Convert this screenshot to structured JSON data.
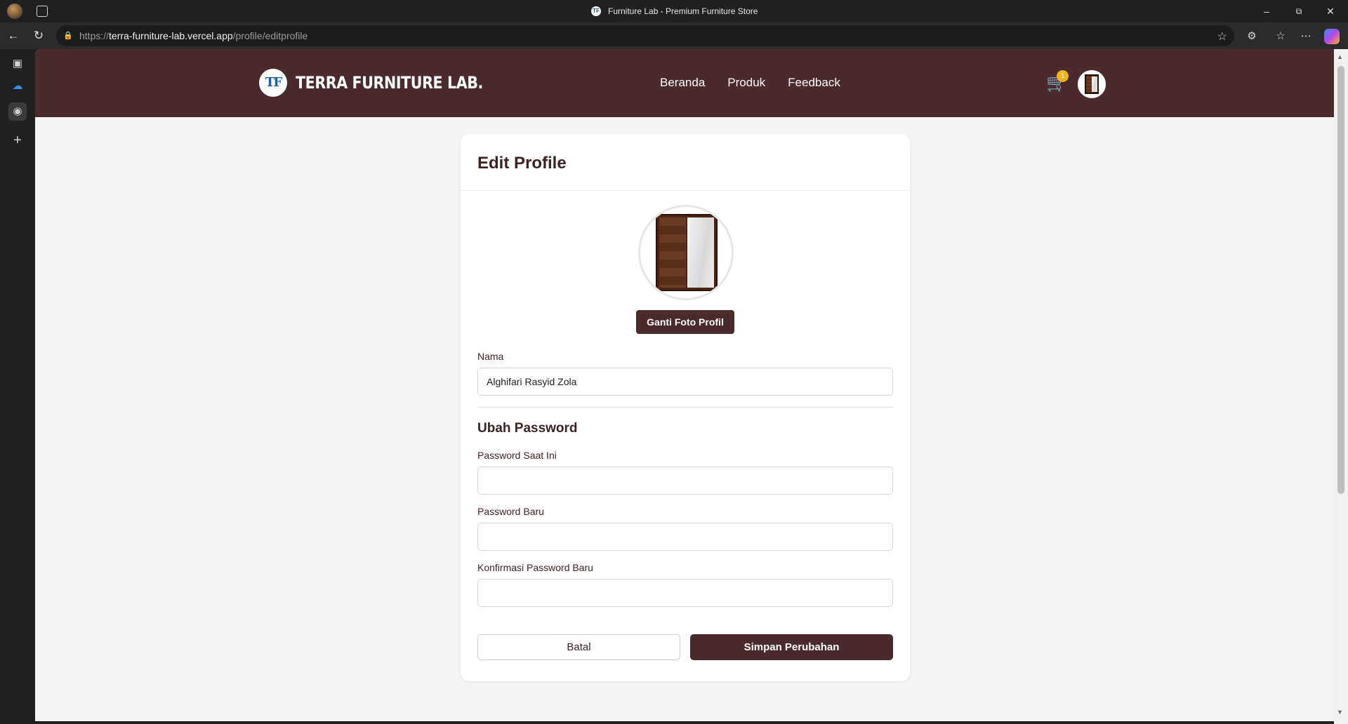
{
  "browser": {
    "tab_title": "Furniture Lab - Premium Furniture Store",
    "tab_favicon": "TF",
    "url_scheme": "https://",
    "url_host": "terra-furniture-lab.vercel.app",
    "url_path": "/profile/editprofile",
    "icons": [
      "profile-icon",
      "tabs-icon",
      "back-icon",
      "refresh-icon",
      "lock-icon",
      "star-icon",
      "extensions-icon",
      "favorites-icon",
      "more-icon",
      "copilot-icon",
      "minimize-icon",
      "restore-icon",
      "close-icon"
    ]
  },
  "site": {
    "brand_logo": "TF",
    "brand_name": "TERRA FURNITURE LAB.",
    "nav": [
      "Beranda",
      "Produk",
      "Feedback"
    ],
    "cart_count": "1",
    "header_color": "#4a2a2c"
  },
  "form": {
    "title": "Edit Profile",
    "change_photo_label": "Ganti Foto Profil",
    "name_label": "Nama",
    "name_value": "Alghifari Rasyid Zola",
    "password_section_title": "Ubah Password",
    "current_password_label": "Password Saat Ini",
    "new_password_label": "Password Baru",
    "confirm_password_label": "Konfirmasi Password Baru",
    "current_password_value": "",
    "new_password_value": "",
    "confirm_password_value": "",
    "cancel_label": "Batal",
    "save_label": "Simpan Perubahan"
  }
}
